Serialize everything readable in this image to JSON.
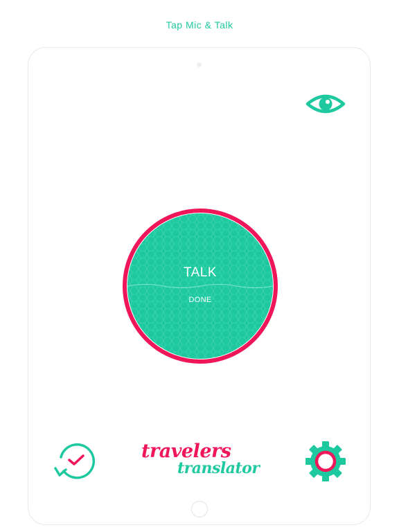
{
  "caption": "Tap Mic & Talk",
  "talk_button": {
    "label": "TALK",
    "done_label": "DONE"
  },
  "logo": {
    "line1": "travelers",
    "line2": "translator"
  },
  "icons": {
    "eye": "eye-icon",
    "history": "history-clock-check-icon",
    "settings": "gear-icon"
  },
  "colors": {
    "accent_green": "#1ec9a0",
    "accent_pink": "#f0165a",
    "background": "#ffffff"
  }
}
